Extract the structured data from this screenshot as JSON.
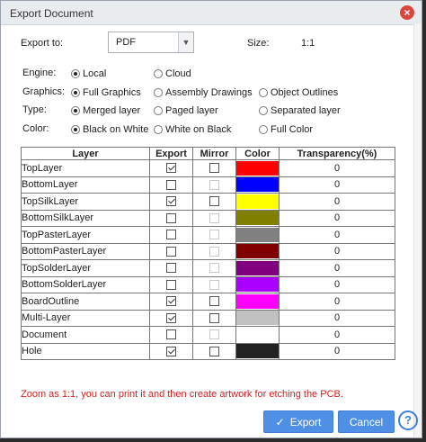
{
  "window": {
    "title": "Export Document",
    "close_glyph": "×"
  },
  "export_to": {
    "label": "Export to:",
    "value": "PDF",
    "size_label": "Size:",
    "size_value": "1:1"
  },
  "engine": {
    "label": "Engine:",
    "options": [
      "Local",
      "Cloud"
    ],
    "selected": "Local"
  },
  "graphics": {
    "label": "Graphics:",
    "options": [
      "Full Graphics",
      "Assembly Drawings",
      "Object Outlines"
    ],
    "selected": "Full Graphics"
  },
  "type": {
    "label": "Type:",
    "options": [
      "Merged layer",
      "Paged layer",
      "Separated layer"
    ],
    "selected": "Merged layer"
  },
  "color": {
    "label": "Color:",
    "options": [
      "Black on White",
      "White on Black",
      "Full Color"
    ],
    "selected": "Black on White"
  },
  "table": {
    "headers": [
      "Layer",
      "Export",
      "Mirror",
      "Color",
      "Transparency(%)"
    ],
    "rows": [
      {
        "name": "TopLayer",
        "export": true,
        "mirror": false,
        "mirror_disabled": false,
        "color": "#ff0000",
        "transparency": "0"
      },
      {
        "name": "BottomLayer",
        "export": false,
        "mirror": false,
        "mirror_disabled": true,
        "color": "#0000ff",
        "transparency": "0"
      },
      {
        "name": "TopSilkLayer",
        "export": true,
        "mirror": false,
        "mirror_disabled": false,
        "color": "#ffff00",
        "transparency": "0"
      },
      {
        "name": "BottomSilkLayer",
        "export": false,
        "mirror": false,
        "mirror_disabled": true,
        "color": "#808000",
        "transparency": "0"
      },
      {
        "name": "TopPasterLayer",
        "export": false,
        "mirror": false,
        "mirror_disabled": true,
        "color": "#808080",
        "transparency": "0"
      },
      {
        "name": "BottomPasterLayer",
        "export": false,
        "mirror": false,
        "mirror_disabled": true,
        "color": "#800000",
        "transparency": "0"
      },
      {
        "name": "TopSolderLayer",
        "export": false,
        "mirror": false,
        "mirror_disabled": true,
        "color": "#800080",
        "transparency": "0"
      },
      {
        "name": "BottomSolderLayer",
        "export": false,
        "mirror": false,
        "mirror_disabled": true,
        "color": "#aa00ff",
        "transparency": "0"
      },
      {
        "name": "BoardOutline",
        "export": true,
        "mirror": false,
        "mirror_disabled": false,
        "color": "#ff00ff",
        "transparency": "0"
      },
      {
        "name": "Multi-Layer",
        "export": true,
        "mirror": false,
        "mirror_disabled": false,
        "color": "#c0c0c0",
        "transparency": "0"
      },
      {
        "name": "Document",
        "export": false,
        "mirror": false,
        "mirror_disabled": true,
        "color": "#ffffff",
        "transparency": "0"
      },
      {
        "name": "Hole",
        "export": true,
        "mirror": false,
        "mirror_disabled": false,
        "color": "#222222",
        "transparency": "0"
      }
    ]
  },
  "note": "Zoom as 1:1, you can print it and then create artwork for etching the PCB.",
  "buttons": {
    "export": "Export",
    "export_icon": "check-icon",
    "cancel": "Cancel",
    "help": "?"
  },
  "colors": {
    "accent": "#4f8fe6",
    "note": "#d32020",
    "close": "#d9463e"
  }
}
